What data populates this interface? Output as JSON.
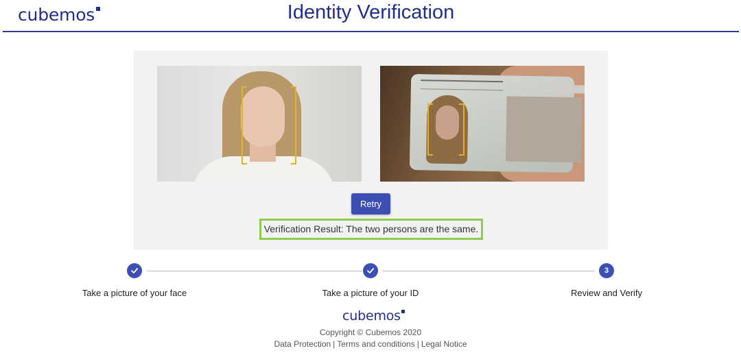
{
  "header": {
    "logo_text": "cubemos",
    "title": "Identity Verification"
  },
  "verification": {
    "face_photo_icon": "face-photo",
    "id_photo_icon": "id-card-photo",
    "retry_label": "Retry",
    "result_text": "Verification Result: The two persons are the same."
  },
  "stepper": {
    "steps": [
      {
        "label": "Take a picture of your face",
        "status": "completed",
        "icon": "check-icon"
      },
      {
        "label": "Take a picture of your ID",
        "status": "completed",
        "icon": "check-icon"
      },
      {
        "label": "Review and Verify",
        "status": "active",
        "number": "3"
      }
    ]
  },
  "footer": {
    "logo_text": "cubemos",
    "copyright": "Copyright © Cubemos 2020",
    "links": [
      "Data Protection",
      "Terms and conditions",
      "Legal Notice"
    ],
    "separator": "|"
  },
  "colors": {
    "brand": "#1f2f8e",
    "button": "#3d4fb2",
    "result_border": "#8bcb4d",
    "detection_box": "#e2b12a",
    "panel_bg": "#f2f2f2"
  }
}
